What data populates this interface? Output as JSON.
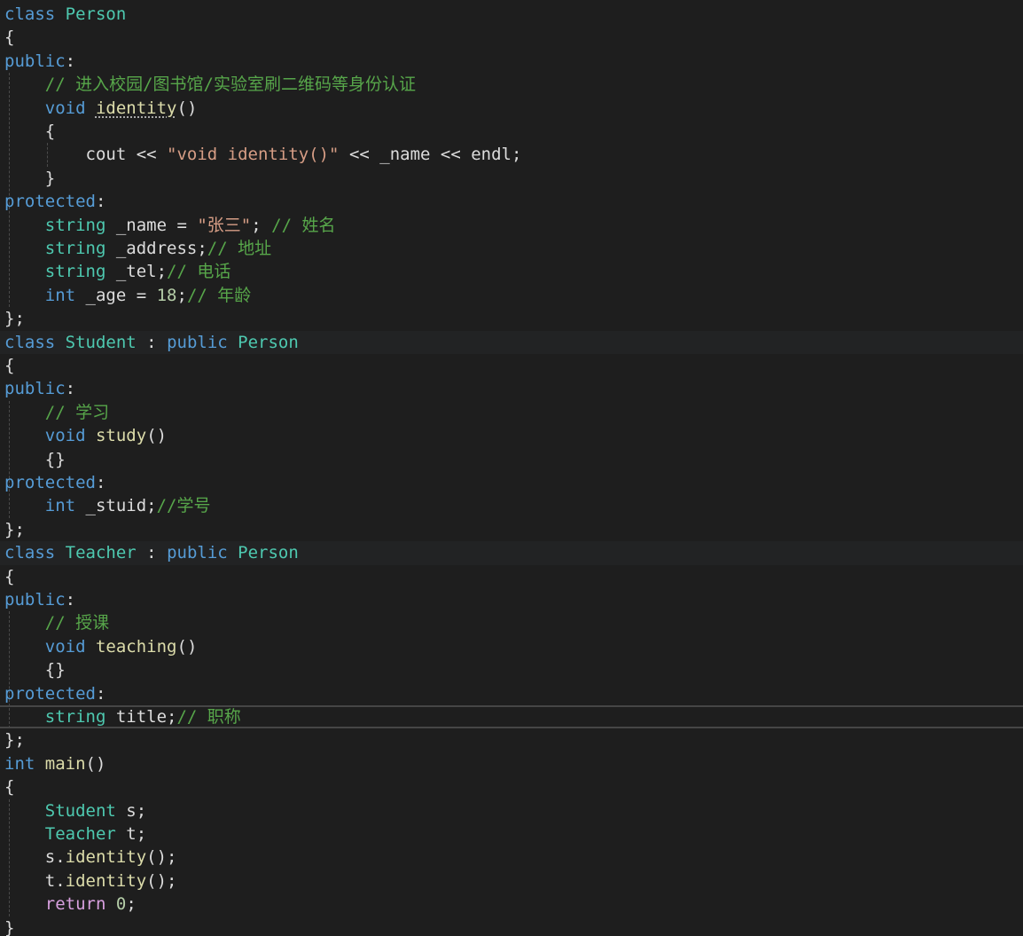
{
  "lines": [
    [
      [
        "kw",
        "class"
      ],
      [
        "pl",
        " "
      ],
      [
        "cls",
        "Person"
      ]
    ],
    [
      [
        "pl",
        "{"
      ]
    ],
    [
      [
        "kw",
        "public"
      ],
      [
        "pl",
        ":"
      ]
    ],
    [
      [
        "pl",
        "    "
      ],
      [
        "cm",
        "// 进入校园/图书馆/实验室刷二维码等身份认证"
      ]
    ],
    [
      [
        "pl",
        "    "
      ],
      [
        "kw",
        "void"
      ],
      [
        "pl",
        " "
      ],
      [
        "fn squig",
        "identity"
      ],
      [
        "pl",
        "()"
      ]
    ],
    [
      [
        "pl",
        "    {"
      ]
    ],
    [
      [
        "pl",
        "        cout << "
      ],
      [
        "str",
        "\"void identity()\""
      ],
      [
        "pl",
        " << _name << endl;"
      ]
    ],
    [
      [
        "pl",
        "    }"
      ]
    ],
    [
      [
        "kw",
        "protected"
      ],
      [
        "pl",
        ":"
      ]
    ],
    [
      [
        "pl",
        "    "
      ],
      [
        "cls",
        "string"
      ],
      [
        "pl",
        " _name = "
      ],
      [
        "str",
        "\"张三\""
      ],
      [
        "pl",
        "; "
      ],
      [
        "cm",
        "// 姓名"
      ]
    ],
    [
      [
        "pl",
        "    "
      ],
      [
        "cls",
        "string"
      ],
      [
        "pl",
        " _address;"
      ],
      [
        "cm",
        "// 地址"
      ]
    ],
    [
      [
        "pl",
        "    "
      ],
      [
        "cls",
        "string"
      ],
      [
        "pl",
        " _tel;"
      ],
      [
        "cm",
        "// 电话"
      ]
    ],
    [
      [
        "pl",
        "    "
      ],
      [
        "kw",
        "int"
      ],
      [
        "pl",
        " _age = "
      ],
      [
        "num",
        "18"
      ],
      [
        "pl",
        ";"
      ],
      [
        "cm",
        "// 年龄"
      ]
    ],
    [
      [
        "pl",
        "};"
      ]
    ],
    [
      [
        "kw",
        "class"
      ],
      [
        "pl",
        " "
      ],
      [
        "cls",
        "Student"
      ],
      [
        "pl",
        " : "
      ],
      [
        "kw",
        "public"
      ],
      [
        "pl",
        " "
      ],
      [
        "cls",
        "Person"
      ]
    ],
    [
      [
        "pl",
        "{"
      ]
    ],
    [
      [
        "kw",
        "public"
      ],
      [
        "pl",
        ":"
      ]
    ],
    [
      [
        "pl",
        "    "
      ],
      [
        "cm",
        "// 学习"
      ]
    ],
    [
      [
        "pl",
        "    "
      ],
      [
        "kw",
        "void"
      ],
      [
        "pl",
        " "
      ],
      [
        "fn",
        "study"
      ],
      [
        "pl",
        "()"
      ]
    ],
    [
      [
        "pl",
        "    {}"
      ]
    ],
    [
      [
        "kw",
        "protected"
      ],
      [
        "pl",
        ":"
      ]
    ],
    [
      [
        "pl",
        "    "
      ],
      [
        "kw",
        "int"
      ],
      [
        "pl",
        " _stuid;"
      ],
      [
        "cm",
        "//学号"
      ]
    ],
    [
      [
        "pl",
        "};"
      ]
    ],
    [
      [
        "kw",
        "class"
      ],
      [
        "pl",
        " "
      ],
      [
        "cls",
        "Teacher"
      ],
      [
        "pl",
        " : "
      ],
      [
        "kw",
        "public"
      ],
      [
        "pl",
        " "
      ],
      [
        "cls",
        "Person"
      ]
    ],
    [
      [
        "pl",
        "{"
      ]
    ],
    [
      [
        "kw",
        "public"
      ],
      [
        "pl",
        ":"
      ]
    ],
    [
      [
        "pl",
        "    "
      ],
      [
        "cm",
        "// 授课"
      ]
    ],
    [
      [
        "pl",
        "    "
      ],
      [
        "kw",
        "void"
      ],
      [
        "pl",
        " "
      ],
      [
        "fn",
        "teaching"
      ],
      [
        "pl",
        "()"
      ]
    ],
    [
      [
        "pl",
        "    {}"
      ]
    ],
    [
      [
        "kw",
        "protected"
      ],
      [
        "pl",
        ":"
      ]
    ],
    [
      [
        "pl",
        "    "
      ],
      [
        "cls",
        "string"
      ],
      [
        "pl",
        " title;"
      ],
      [
        "cm",
        "// 职称"
      ]
    ],
    [
      [
        "pl",
        "};"
      ]
    ],
    [
      [
        "kw",
        "int"
      ],
      [
        "pl",
        " "
      ],
      [
        "fn",
        "main"
      ],
      [
        "pl",
        "()"
      ]
    ],
    [
      [
        "pl",
        "{"
      ]
    ],
    [
      [
        "pl",
        "    "
      ],
      [
        "cls",
        "Student"
      ],
      [
        "pl",
        " s;"
      ]
    ],
    [
      [
        "pl",
        "    "
      ],
      [
        "cls",
        "Teacher"
      ],
      [
        "pl",
        " t;"
      ]
    ],
    [
      [
        "pl",
        "    s."
      ],
      [
        "fn",
        "identity"
      ],
      [
        "pl",
        "();"
      ]
    ],
    [
      [
        "pl",
        "    t."
      ],
      [
        "fn",
        "identity"
      ],
      [
        "pl",
        "();"
      ]
    ],
    [
      [
        "pl",
        "    "
      ],
      [
        "ret",
        "return"
      ],
      [
        "pl",
        " "
      ],
      [
        "num",
        "0"
      ],
      [
        "pl",
        ";"
      ]
    ],
    [
      [
        "pl",
        "}"
      ]
    ]
  ],
  "highlight_lines": [
    14,
    23
  ],
  "cursor_line": 30
}
